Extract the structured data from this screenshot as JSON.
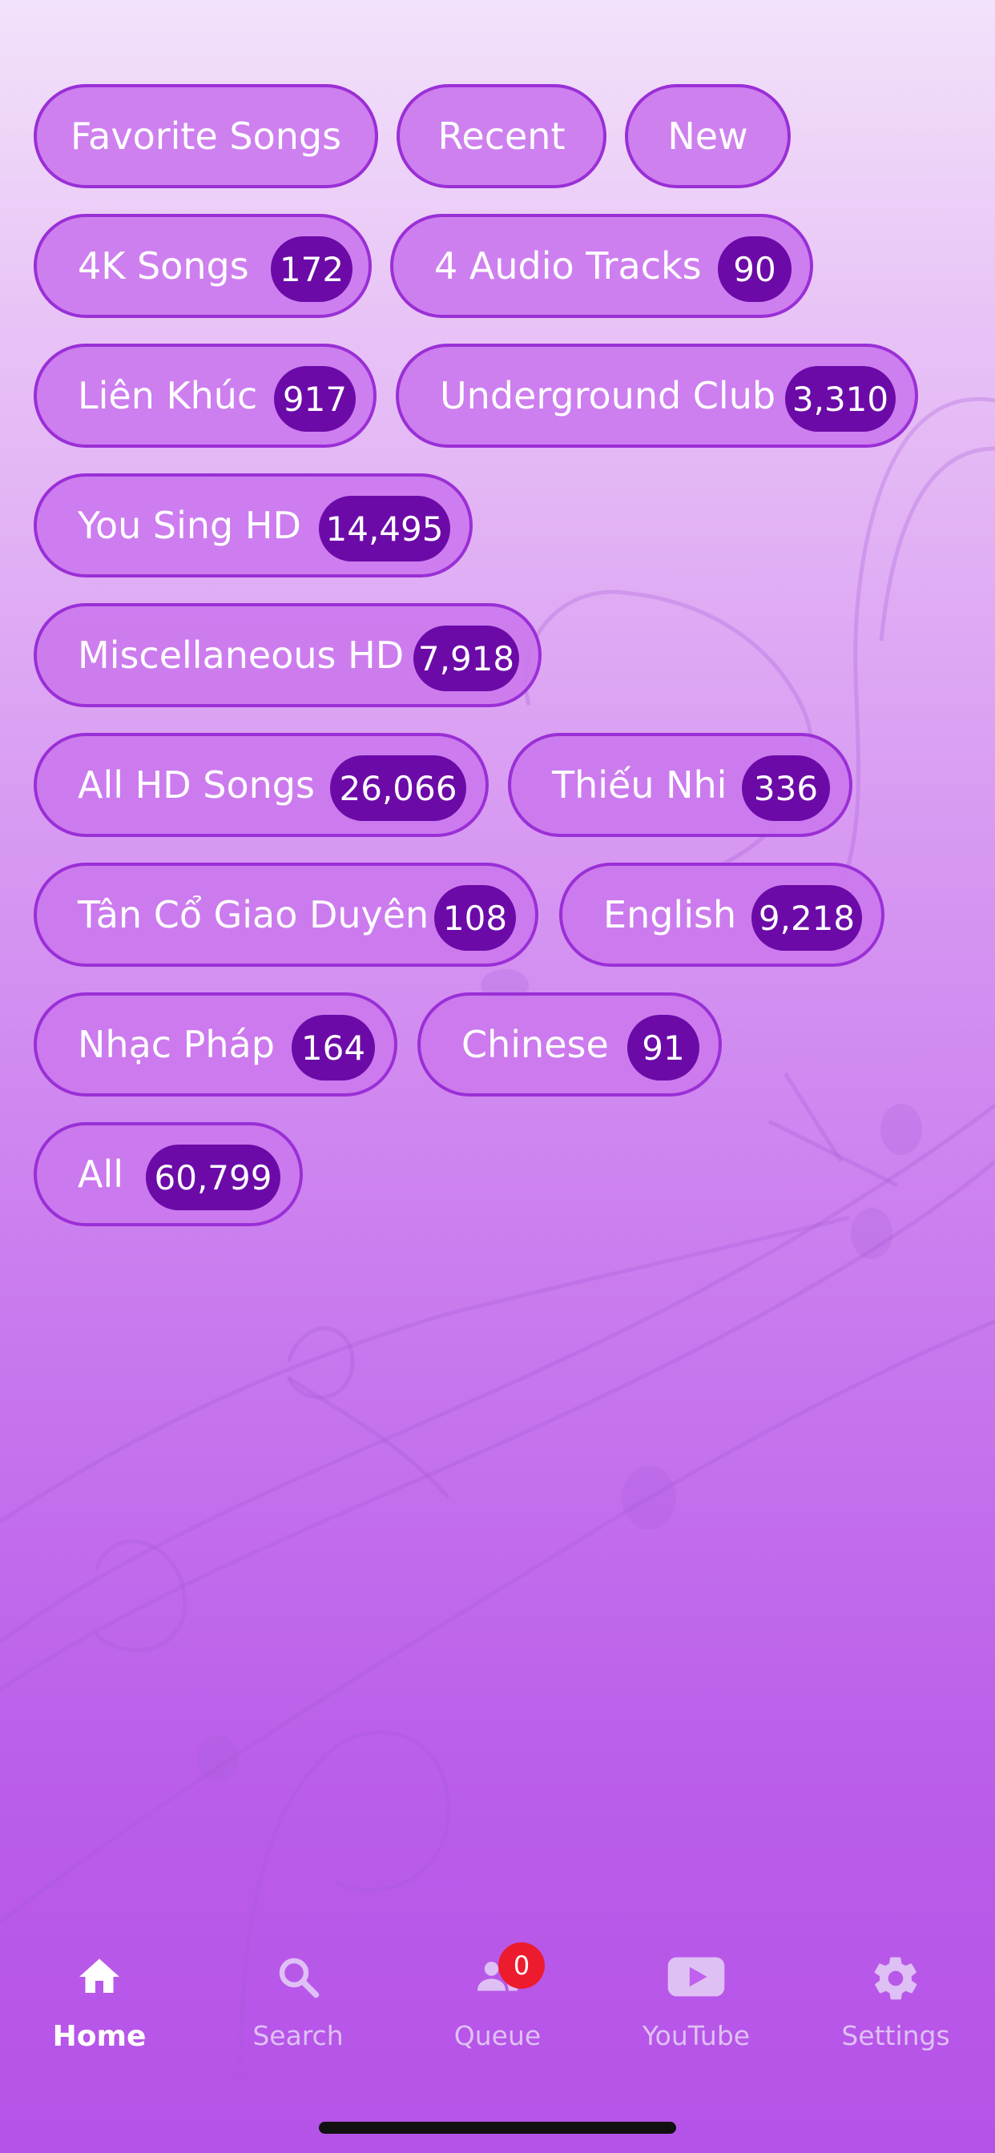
{
  "categories": [
    {
      "label": "Favorite Songs",
      "count": null
    },
    {
      "label": "Recent",
      "count": null
    },
    {
      "label": "New",
      "count": null
    },
    {
      "label": "4K Songs",
      "count": "172"
    },
    {
      "label": "4 Audio Tracks",
      "count": "90"
    },
    {
      "label": "Liên Khúc",
      "count": "917"
    },
    {
      "label": "Underground Club",
      "count": "3,310"
    },
    {
      "label": "You Sing HD",
      "count": "14,495"
    },
    {
      "label": "Miscellaneous HD",
      "count": "7,918"
    },
    {
      "label": "All HD Songs",
      "count": "26,066"
    },
    {
      "label": "Thiếu Nhi",
      "count": "336"
    },
    {
      "label": "Tân Cổ Giao Duyên",
      "count": "108"
    },
    {
      "label": "English",
      "count": "9,218"
    },
    {
      "label": "Nhạc Pháp",
      "count": "164"
    },
    {
      "label": "Chinese",
      "count": "91"
    },
    {
      "label": "All",
      "count": "60,799"
    }
  ],
  "tabbar": {
    "items": [
      {
        "label": "Home",
        "icon": "home-icon",
        "active": true
      },
      {
        "label": "Search",
        "icon": "search-icon",
        "active": false
      },
      {
        "label": "Queue",
        "icon": "people-icon",
        "active": false
      },
      {
        "label": "YouTube",
        "icon": "youtube-icon",
        "active": false
      },
      {
        "label": "Settings",
        "icon": "gear-icon",
        "active": false
      }
    ],
    "queue_count": "0"
  },
  "colors": {
    "chip_fill": "#cb78ee",
    "chip_border": "#9a2fd6",
    "badge_fill": "#6c0aa8",
    "tab_inactive": "#dfc0f5",
    "tab_active": "#ffffff",
    "queue_badge": "#ec1c2e"
  }
}
